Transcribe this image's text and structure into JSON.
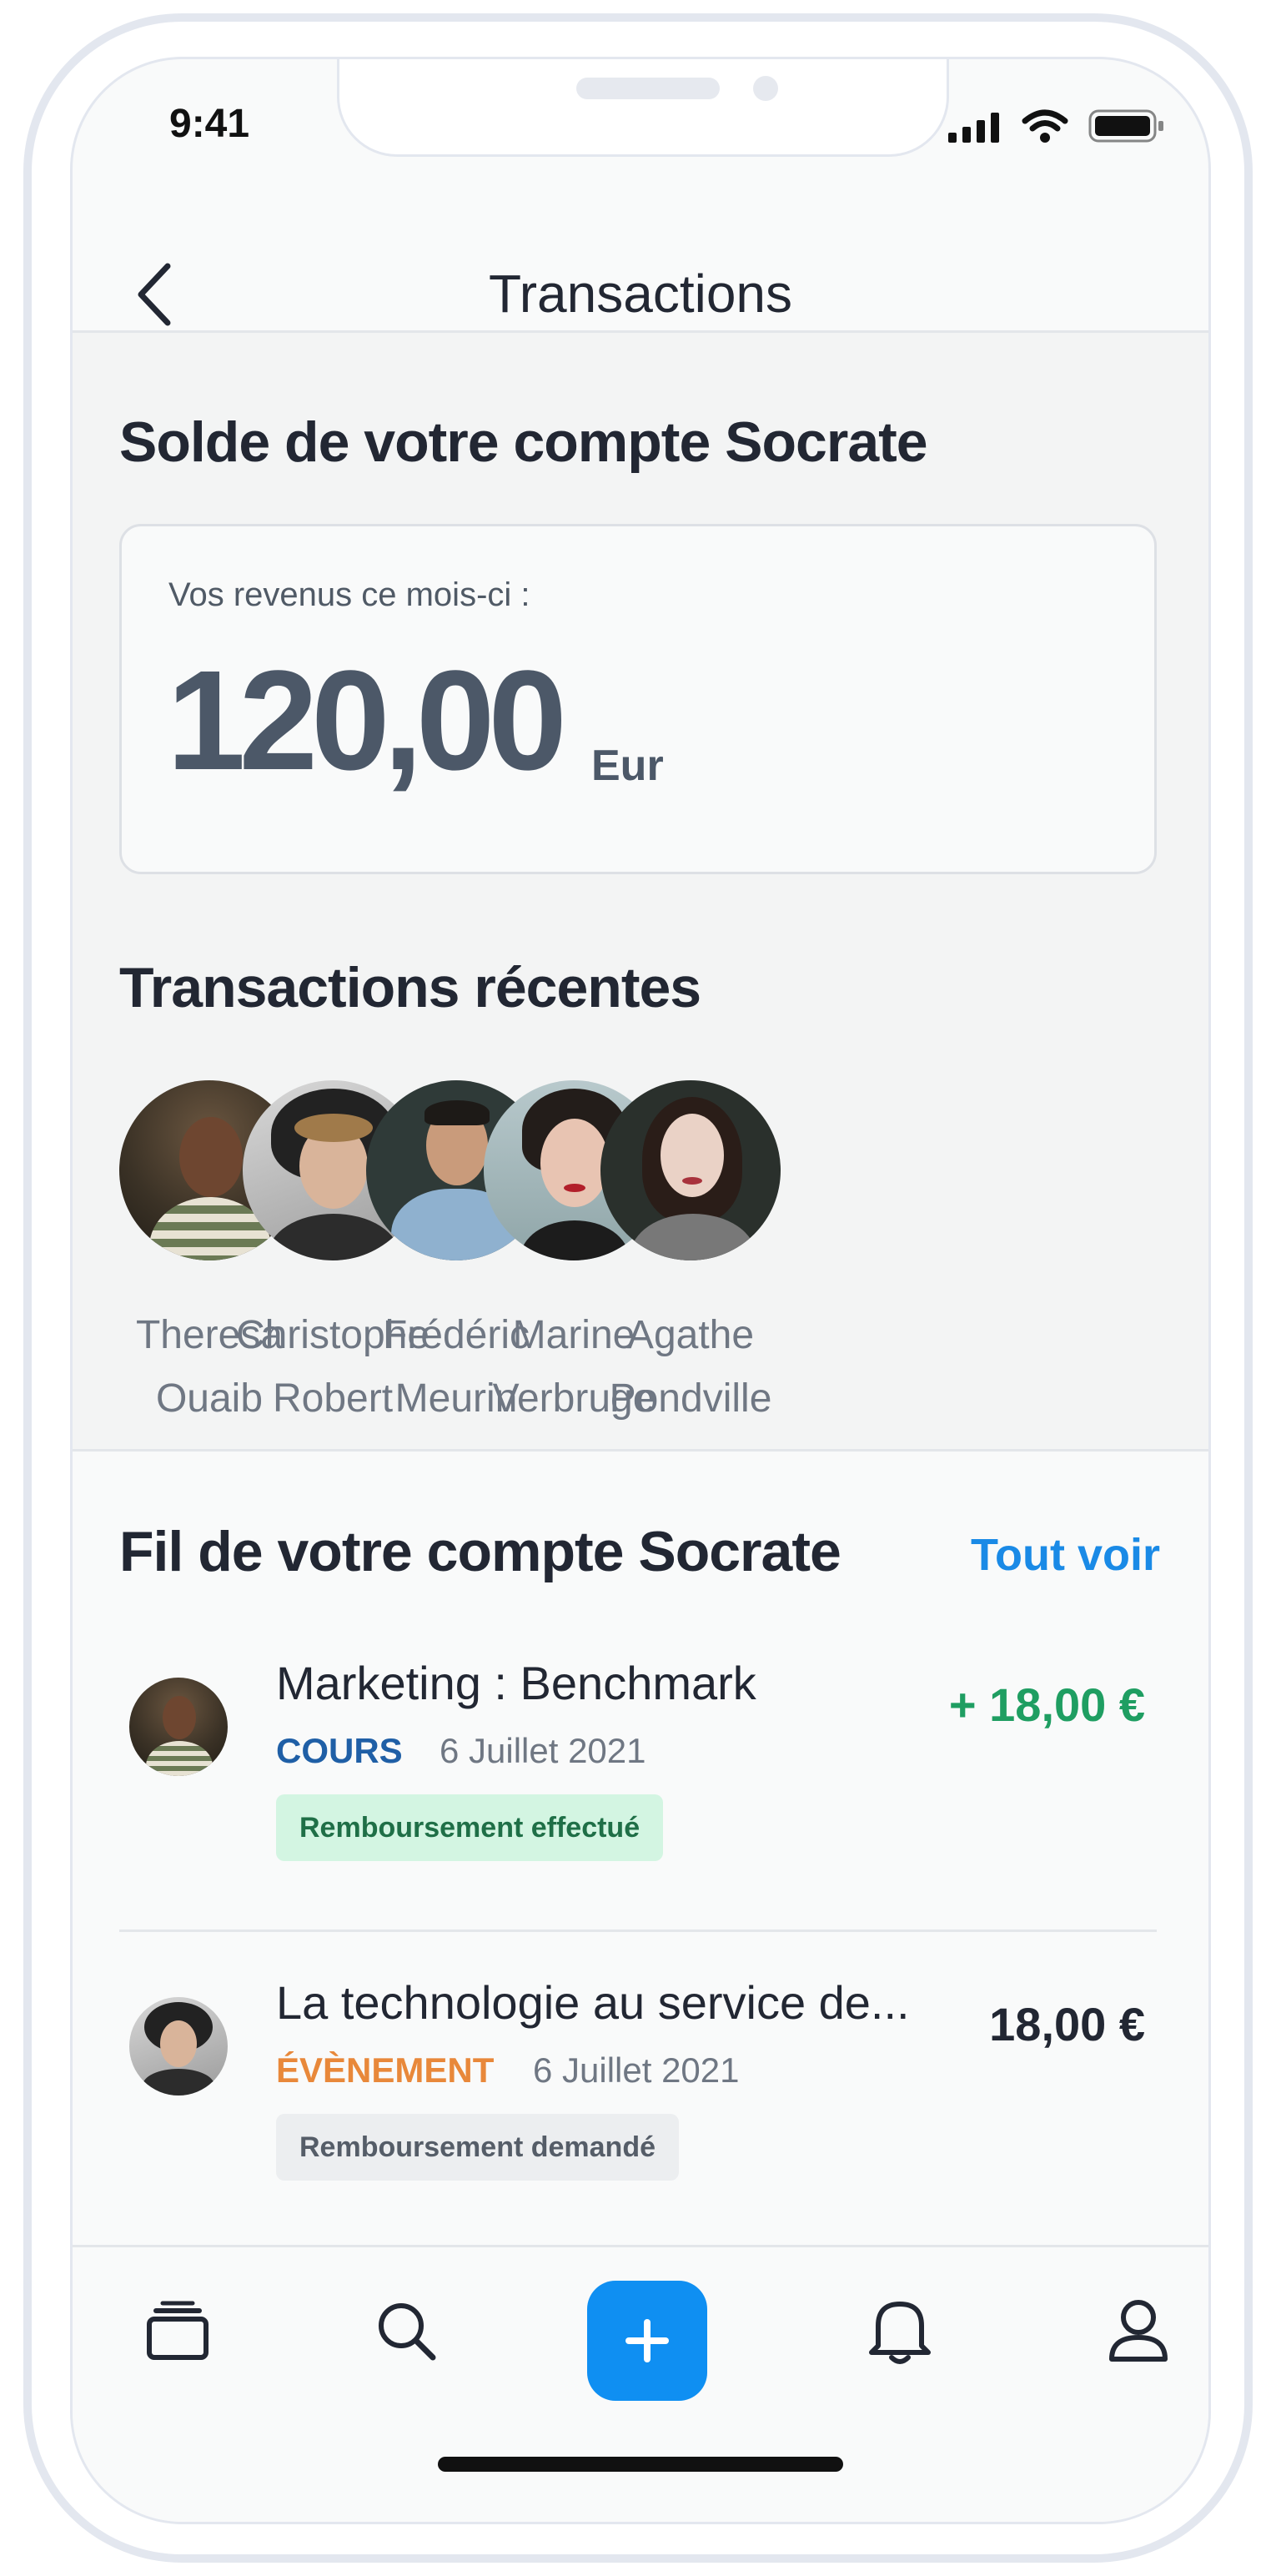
{
  "status": {
    "time": "9:41"
  },
  "nav": {
    "title": "Transactions"
  },
  "balance": {
    "title": "Solde de votre compte Socrate",
    "label": "Vos revenus ce mois-ci :",
    "amount": "120,00",
    "unit": "Eur"
  },
  "recent": {
    "title": "Transactions récentes",
    "people": [
      {
        "first": "Theresa",
        "last": "Ouaib"
      },
      {
        "first": "Christophe",
        "last": "Robert"
      },
      {
        "first": "Frédéric",
        "last": "Meurin"
      },
      {
        "first": "Marine",
        "last": "Verbruge"
      },
      {
        "first": "Agathe",
        "last": "Pondville"
      }
    ]
  },
  "feed": {
    "title": "Fil de votre compte Socrate",
    "see_all": "Tout voir",
    "items": [
      {
        "title": "Marketing : Benchmark",
        "category": "COURS",
        "date": "6 Juillet 2021",
        "status": "Remboursement effectué",
        "amount": "+ 18,00 €"
      },
      {
        "title": "La technologie au service de...",
        "category": "ÉVÈNEMENT",
        "date": "6 Juillet 2021",
        "status": "Remboursement demandé",
        "amount": "18,00 €"
      }
    ]
  },
  "tabs": [
    "courses-icon",
    "search-icon",
    "add-icon",
    "bell-icon",
    "profile-icon"
  ],
  "colors": {
    "accent": "#1a8ae6",
    "positive": "#1f9e62",
    "cours": "#1f5fa6",
    "evenement": "#e8883a"
  }
}
